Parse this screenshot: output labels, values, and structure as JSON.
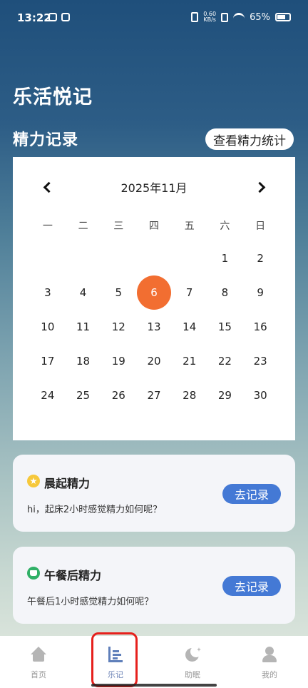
{
  "status_bar": {
    "time": "13:22",
    "speed_value": "0.60",
    "speed_unit": "KB/s",
    "battery": "65%"
  },
  "header": {
    "app_title": "乐活悦记",
    "section_title": "精力记录",
    "stats_button": "查看精力统计"
  },
  "calendar": {
    "month_label": "2025年11月",
    "weekdays": [
      "一",
      "二",
      "三",
      "四",
      "五",
      "六",
      "日"
    ],
    "selected_day": 6,
    "days": [
      "",
      "",
      "",
      "",
      "",
      "1",
      "2",
      "3",
      "4",
      "5",
      "6",
      "7",
      "8",
      "9",
      "10",
      "11",
      "12",
      "13",
      "14",
      "15",
      "16",
      "17",
      "18",
      "19",
      "20",
      "21",
      "22",
      "23",
      "24",
      "25",
      "26",
      "27",
      "28",
      "29",
      "30"
    ]
  },
  "cards": [
    {
      "title": "晨起精力",
      "desc": "hi，起床2小时感觉精力如何呢？",
      "button": "去记录",
      "icon": "star-icon"
    },
    {
      "title": "午餐后精力",
      "desc": "午餐后1小时感觉精力如何呢？",
      "button": "去记录",
      "icon": "coffee-icon"
    }
  ],
  "nav": {
    "items": [
      {
        "label": "首页",
        "icon": "home-icon"
      },
      {
        "label": "乐记",
        "icon": "notes-icon"
      },
      {
        "label": "助眠",
        "icon": "moon-icon"
      },
      {
        "label": "我的",
        "icon": "user-icon"
      }
    ],
    "active": "乐记"
  },
  "colors": {
    "selected_day": "#f26e31",
    "record_button": "#4479d5",
    "highlight": "#e6201c"
  }
}
